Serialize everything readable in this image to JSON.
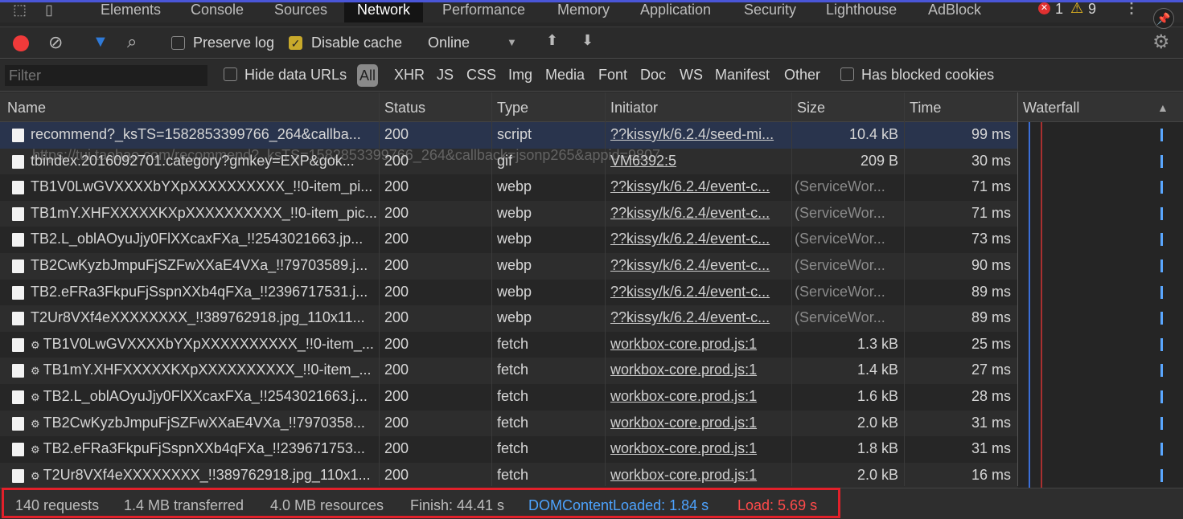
{
  "tabs": [
    {
      "label": "Elements"
    },
    {
      "label": "Console"
    },
    {
      "label": "Sources"
    },
    {
      "label": "Network"
    },
    {
      "label": "Performance"
    },
    {
      "label": "Memory"
    },
    {
      "label": "Application"
    },
    {
      "label": "Security"
    },
    {
      "label": "Lighthouse"
    },
    {
      "label": "AdBlock"
    }
  ],
  "active_tab": "Network",
  "errors": "1",
  "warnings": "9",
  "toolbar": {
    "preserve_log": "Preserve log",
    "preserve_log_checked": false,
    "disable_cache": "Disable cache",
    "disable_cache_checked": true,
    "throttling": "Online"
  },
  "filterbar": {
    "filter_placeholder": "Filter",
    "hide_data_urls": "Hide data URLs",
    "types": [
      "All",
      "XHR",
      "JS",
      "CSS",
      "Img",
      "Media",
      "Font",
      "Doc",
      "WS",
      "Manifest",
      "Other"
    ],
    "has_blocked_cookies": "Has blocked cookies"
  },
  "columns": {
    "name": "Name",
    "status": "Status",
    "type": "Type",
    "initiator": "Initiator",
    "size": "Size",
    "time": "Time",
    "waterfall": "Waterfall"
  },
  "tooltip": "https://tui.taobao.com/recommend?_ksTS=1582853399766_264&callback=jsonp265&appid=9807",
  "rows": [
    {
      "name": "recommend?_ksTS=1582853399766_264&callba...",
      "status": "200",
      "type": "script",
      "initiator": "??kissy/k/6.2.4/seed-mi...",
      "size": "10.4 kB",
      "time": "99 ms"
    },
    {
      "name": "tbindex.2016092701.category?gmkey=EXP&gok...",
      "status": "200",
      "type": "gif",
      "initiator": "VM6392:5",
      "size": "209 B",
      "time": "30 ms"
    },
    {
      "name": "TB1V0LwGVXXXXbYXpXXXXXXXXXX_!!0-item_pi...",
      "status": "200",
      "type": "webp",
      "initiator": "??kissy/k/6.2.4/event-c...",
      "size": "(ServiceWor...",
      "time": "71 ms"
    },
    {
      "name": "TB1mY.XHFXXXXXKXpXXXXXXXXXX_!!0-item_pic...",
      "status": "200",
      "type": "webp",
      "initiator": "??kissy/k/6.2.4/event-c...",
      "size": "(ServiceWor...",
      "time": "71 ms"
    },
    {
      "name": "TB2.L_oblAOyuJjy0FlXXcaxFXa_!!2543021663.jp...",
      "status": "200",
      "type": "webp",
      "initiator": "??kissy/k/6.2.4/event-c...",
      "size": "(ServiceWor...",
      "time": "73 ms"
    },
    {
      "name": "TB2CwKyzbJmpuFjSZFwXXaE4VXa_!!79703589.j...",
      "status": "200",
      "type": "webp",
      "initiator": "??kissy/k/6.2.4/event-c...",
      "size": "(ServiceWor...",
      "time": "90 ms"
    },
    {
      "name": "TB2.eFRa3FkpuFjSspnXXb4qFXa_!!2396717531.j...",
      "status": "200",
      "type": "webp",
      "initiator": "??kissy/k/6.2.4/event-c...",
      "size": "(ServiceWor...",
      "time": "89 ms"
    },
    {
      "name": "T2Ur8VXf4eXXXXXXXX_!!389762918.jpg_110x11...",
      "status": "200",
      "type": "webp",
      "initiator": "??kissy/k/6.2.4/event-c...",
      "size": "(ServiceWor...",
      "time": "89 ms"
    },
    {
      "name": "TB1V0LwGVXXXXbYXpXXXXXXXXXX_!!0-item_...",
      "status": "200",
      "type": "fetch",
      "initiator": "workbox-core.prod.js:1",
      "size": "1.3 kB",
      "time": "25 ms"
    },
    {
      "name": "TB1mY.XHFXXXXXKXpXXXXXXXXXX_!!0-item_...",
      "status": "200",
      "type": "fetch",
      "initiator": "workbox-core.prod.js:1",
      "size": "1.4 kB",
      "time": "27 ms"
    },
    {
      "name": "TB2.L_oblAOyuJjy0FlXXcaxFXa_!!2543021663.j...",
      "status": "200",
      "type": "fetch",
      "initiator": "workbox-core.prod.js:1",
      "size": "1.6 kB",
      "time": "28 ms"
    },
    {
      "name": "TB2CwKyzbJmpuFjSZFwXXaE4VXa_!!7970358...",
      "status": "200",
      "type": "fetch",
      "initiator": "workbox-core.prod.js:1",
      "size": "2.0 kB",
      "time": "31 ms"
    },
    {
      "name": "TB2.eFRa3FkpuFjSspnXXb4qFXa_!!239671753...",
      "status": "200",
      "type": "fetch",
      "initiator": "workbox-core.prod.js:1",
      "size": "1.8 kB",
      "time": "31 ms"
    },
    {
      "name": "T2Ur8VXf4eXXXXXXXX_!!389762918.jpg_110x1...",
      "status": "200",
      "type": "fetch",
      "initiator": "workbox-core.prod.js:1",
      "size": "2.0 kB",
      "time": "16 ms"
    }
  ],
  "footer": {
    "requests": "140 requests",
    "transferred": "1.4 MB transferred",
    "resources": "4.0 MB resources",
    "finish": "Finish: 44.41 s",
    "dcl": "DOMContentLoaded: 1.84 s",
    "load": "Load: 5.69 s"
  },
  "colors": {
    "dcl": "#4da3ff",
    "load": "#ff4a4a",
    "highlight": "#e2202a"
  }
}
